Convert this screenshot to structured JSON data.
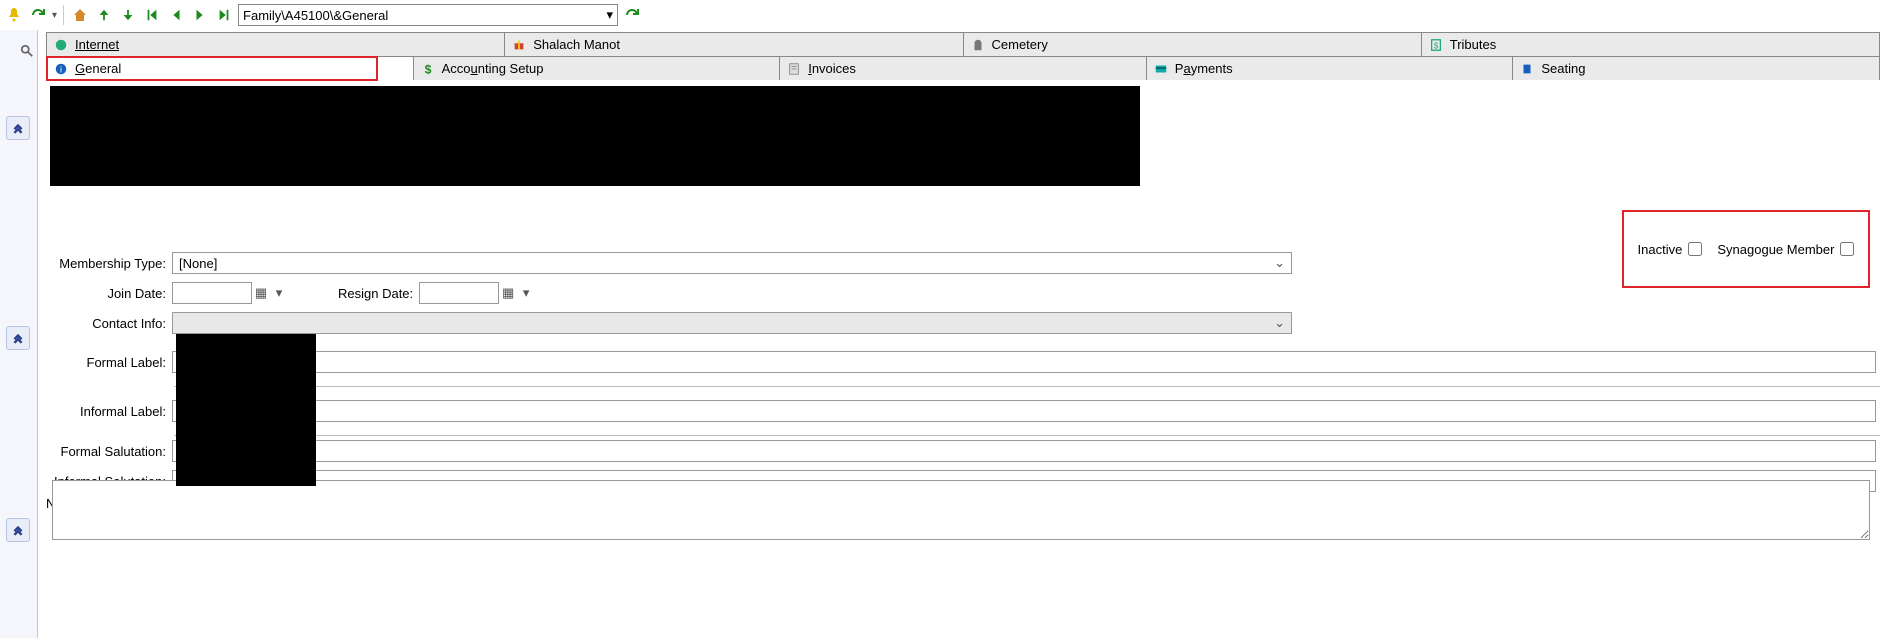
{
  "toolbar": {
    "breadcrumb": "Family\\A45100\\&General"
  },
  "tabs_row1": [
    {
      "label": "Internet"
    },
    {
      "label": "Shalach Manot"
    },
    {
      "label": "Cemetery"
    },
    {
      "label": "Tributes"
    }
  ],
  "tabs_row2": [
    {
      "label": "General"
    },
    {
      "label": "Accounting Setup"
    },
    {
      "label": "Invoices"
    },
    {
      "label": "Payments"
    },
    {
      "label": "Seating"
    }
  ],
  "form": {
    "membership_type_label": "Membership Type:",
    "membership_type_value": "[None]",
    "join_date_label": "Join Date:",
    "join_date_value": "",
    "resign_date_label": "Resign Date:",
    "resign_date_value": "",
    "contact_info_label": "Contact Info:",
    "contact_info_value": "",
    "formal_label_label": "Formal Label:",
    "informal_label_label": "Informal Label:",
    "formal_salutation_label": "Formal Salutation:",
    "informal_salutation_label": "Informal Salutation:",
    "notes_label": "Notes:"
  },
  "checks": {
    "inactive_label": "Inactive",
    "syn_member_label": "Synagogue Member"
  }
}
